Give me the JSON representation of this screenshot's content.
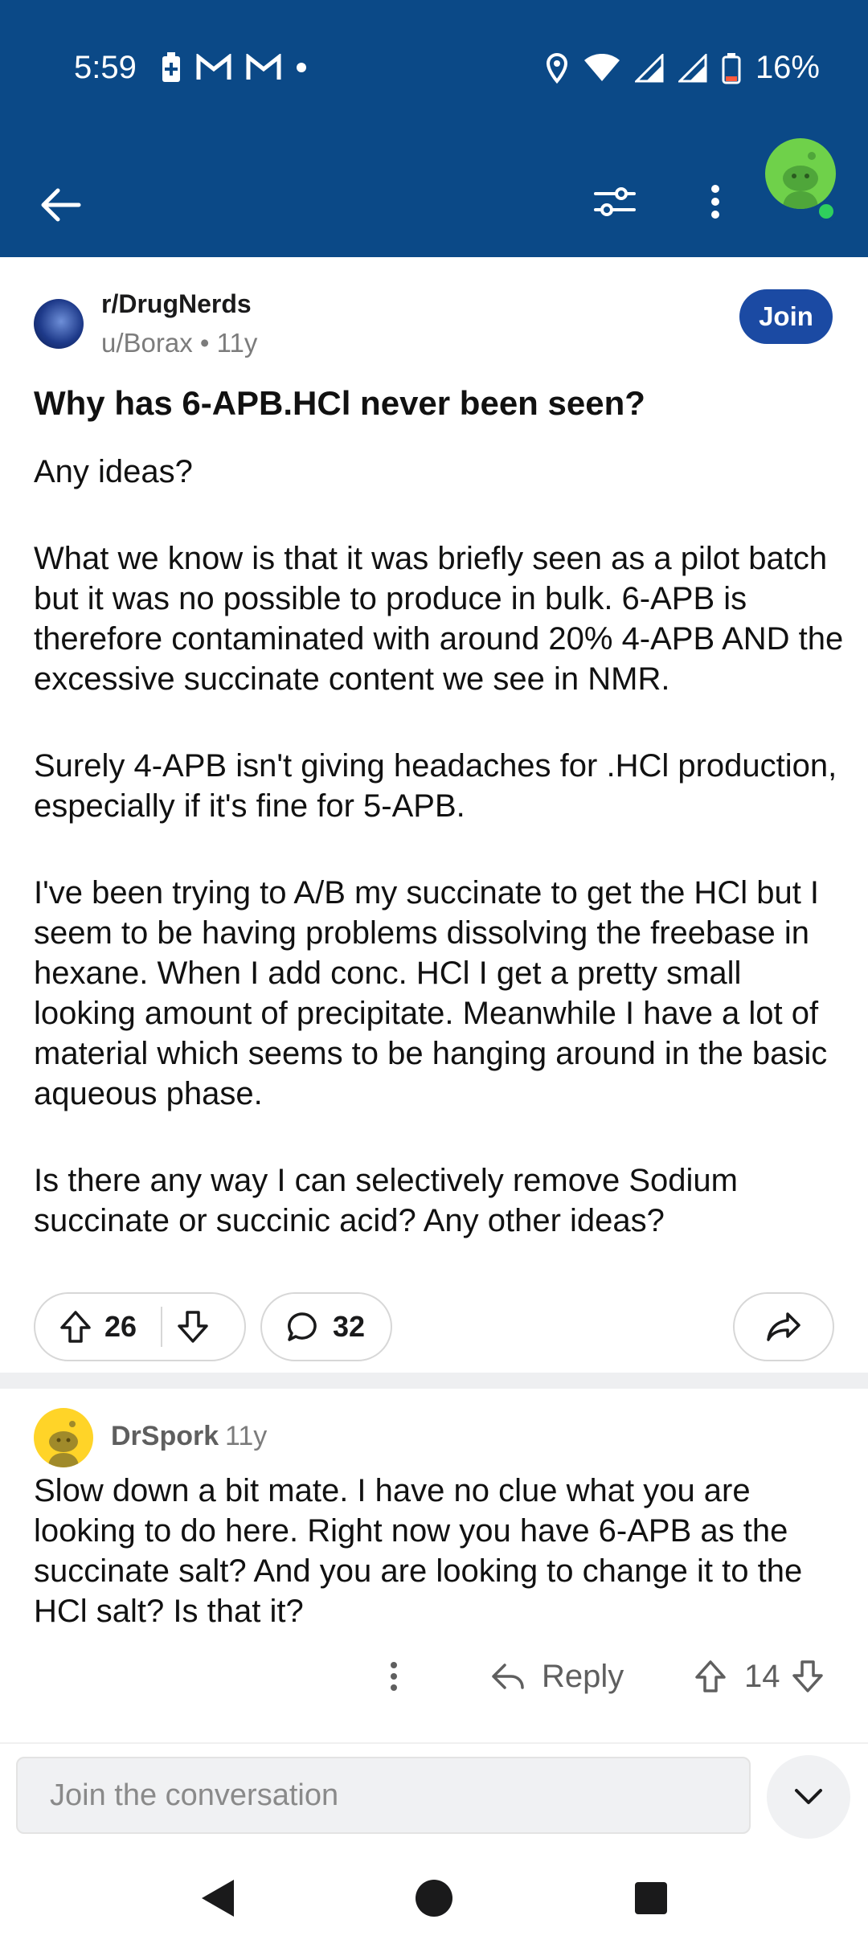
{
  "status_bar": {
    "time": "5:59",
    "battery": "16%"
  },
  "post": {
    "subreddit": "r/DrugNerds",
    "author": "u/Borax",
    "age": "11y",
    "join_label": "Join",
    "title": "Why has 6-APB.HCl never been seen?",
    "paragraphs": [
      "Any ideas?",
      "What we know is that it was briefly seen as a pilot batch but it was no possible to produce in bulk. 6-APB is therefore contaminated with around 20% 4-APB AND the excessive succinate content we see in NMR.",
      "Surely 4-APB isn't giving headaches for .HCl production, especially if it's fine for 5-APB.",
      "I've been trying to A/B my succinate to get the HCl but I seem to be having problems dissolving the freebase in hexane. When I add conc. HCl I get a pretty small looking amount of precipitate. Meanwhile I have a lot of material which seems to be hanging around in the basic aqueous phase.",
      "Is there any way I can selectively remove Sodium succinate or succinic acid? Any other ideas?"
    ],
    "upvotes": "26",
    "comments": "32"
  },
  "comment": {
    "author": "DrSpork",
    "age": "11y",
    "body": "Slow down a bit mate. I have no clue what you are looking to do here. Right now you have 6-APB as the succinate salt? And you are looking to change it to the HCl salt? Is that it?",
    "reply_label": "Reply",
    "votes": "14"
  },
  "composer": {
    "placeholder": "Join the conversation"
  }
}
